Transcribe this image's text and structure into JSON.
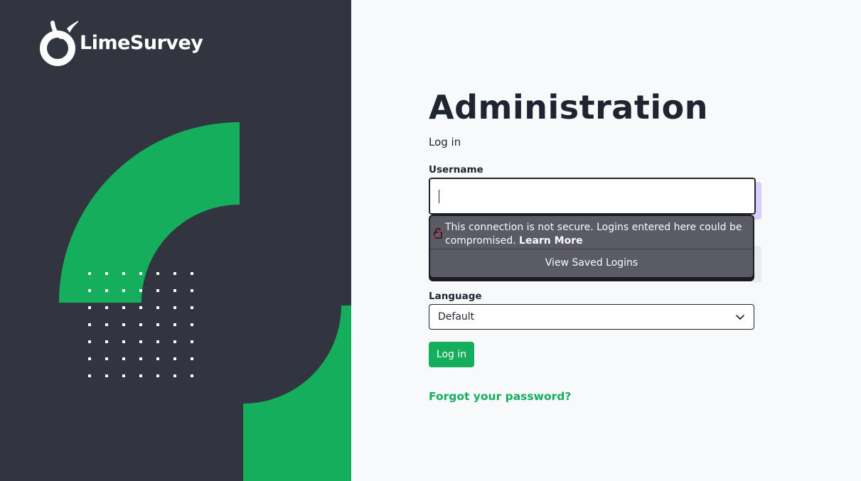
{
  "brand": {
    "name": "LimeSurvey",
    "accent_color": "#14ae5c",
    "panel_color": "#32353f"
  },
  "page": {
    "title": "Administration",
    "subtitle": "Log in"
  },
  "form": {
    "username_label": "Username",
    "username_value": "",
    "language_label": "Language",
    "language_selected": "Default",
    "login_button": "Log in",
    "forgot_link": "Forgot your password?"
  },
  "autofill_popup": {
    "warning_text": "This connection is not secure. Logins entered here could be compromised.",
    "learn_more": "Learn More",
    "view_saved": "View Saved Logins",
    "icon": "insecure-lock-icon"
  },
  "icons": [
    "limesurvey-logo-icon",
    "insecure-lock-icon",
    "chevron-down-icon"
  ]
}
